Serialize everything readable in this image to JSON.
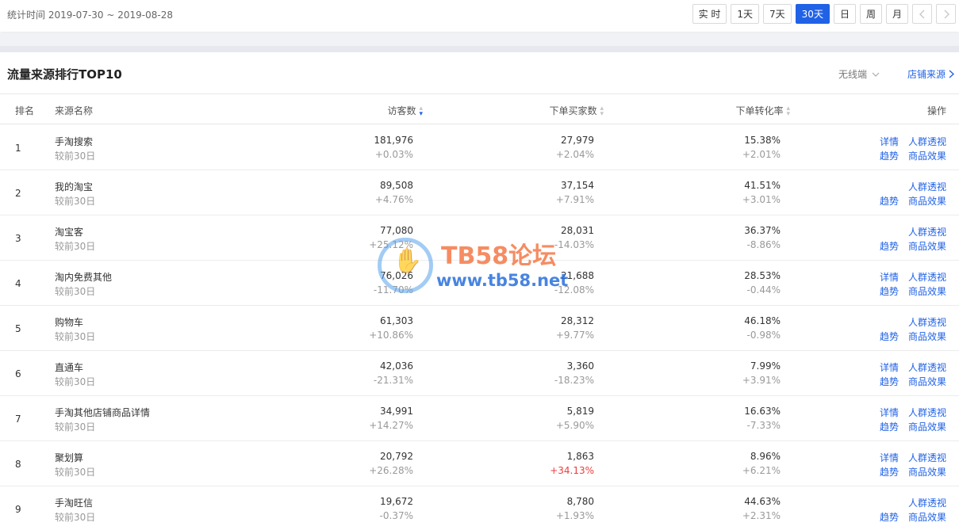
{
  "header": {
    "stat_time": "统计时间 2019-07-30 ~ 2019-08-28",
    "range_buttons": [
      "实 时",
      "1天",
      "7天",
      "30天",
      "日",
      "周",
      "月"
    ],
    "active_range": "30天"
  },
  "panel": {
    "title": "流量来源排行TOP10",
    "device": "无线端",
    "shop_source": "店铺来源"
  },
  "table": {
    "columns": {
      "rank": "排名",
      "source": "来源名称",
      "visitors": "访客数",
      "buyers": "下单买家数",
      "conversion": "下单转化率",
      "action": "操作"
    },
    "compare_label": "较前30日",
    "link_labels": {
      "detail": "详情",
      "trend": "趋势",
      "crowd": "人群透视",
      "goods": "商品效果"
    },
    "rows": [
      {
        "rank": "1",
        "name": "手淘搜索",
        "visitors": "181,976",
        "visitors_chg": "+0.03%",
        "buyers": "27,979",
        "buyers_chg": "+2.04%",
        "conv": "15.38%",
        "conv_chg": "+2.01%",
        "has_detail": true
      },
      {
        "rank": "2",
        "name": "我的淘宝",
        "visitors": "89,508",
        "visitors_chg": "+4.76%",
        "buyers": "37,154",
        "buyers_chg": "+7.91%",
        "conv": "41.51%",
        "conv_chg": "+3.01%",
        "has_detail": false
      },
      {
        "rank": "3",
        "name": "淘宝客",
        "visitors": "77,080",
        "visitors_chg": "+25.12%",
        "buyers": "28,031",
        "buyers_chg": "-14.03%",
        "conv": "36.37%",
        "conv_chg": "-8.86%",
        "has_detail": false
      },
      {
        "rank": "4",
        "name": "淘内免费其他",
        "visitors": "76,026",
        "visitors_chg": "-11.70%",
        "buyers": "21,688",
        "buyers_chg": "-12.08%",
        "conv": "28.53%",
        "conv_chg": "-0.44%",
        "has_detail": true
      },
      {
        "rank": "5",
        "name": "购物车",
        "visitors": "61,303",
        "visitors_chg": "+10.86%",
        "buyers": "28,312",
        "buyers_chg": "+9.77%",
        "conv": "46.18%",
        "conv_chg": "-0.98%",
        "has_detail": false
      },
      {
        "rank": "6",
        "name": "直通车",
        "visitors": "42,036",
        "visitors_chg": "-21.31%",
        "buyers": "3,360",
        "buyers_chg": "-18.23%",
        "conv": "7.99%",
        "conv_chg": "+3.91%",
        "has_detail": true
      },
      {
        "rank": "7",
        "name": "手淘其他店铺商品详情",
        "visitors": "34,991",
        "visitors_chg": "+14.27%",
        "buyers": "5,819",
        "buyers_chg": "+5.90%",
        "conv": "16.63%",
        "conv_chg": "-7.33%",
        "has_detail": true
      },
      {
        "rank": "8",
        "name": "聚划算",
        "visitors": "20,792",
        "visitors_chg": "+26.28%",
        "buyers": "1,863",
        "buyers_chg": "+34.13%",
        "buyers_chg_red": true,
        "conv": "8.96%",
        "conv_chg": "+6.21%",
        "has_detail": true
      },
      {
        "rank": "9",
        "name": "手淘旺信",
        "visitors": "19,672",
        "visitors_chg": "-0.37%",
        "buyers": "8,780",
        "buyers_chg": "+1.93%",
        "conv": "44.63%",
        "conv_chg": "+2.31%",
        "has_detail": false
      }
    ]
  },
  "watermark": {
    "line1": "TB58论坛",
    "line2": "www.tb58.net"
  },
  "colors": {
    "accent": "#2062e6",
    "negative_highlight": "#f03c3c"
  }
}
